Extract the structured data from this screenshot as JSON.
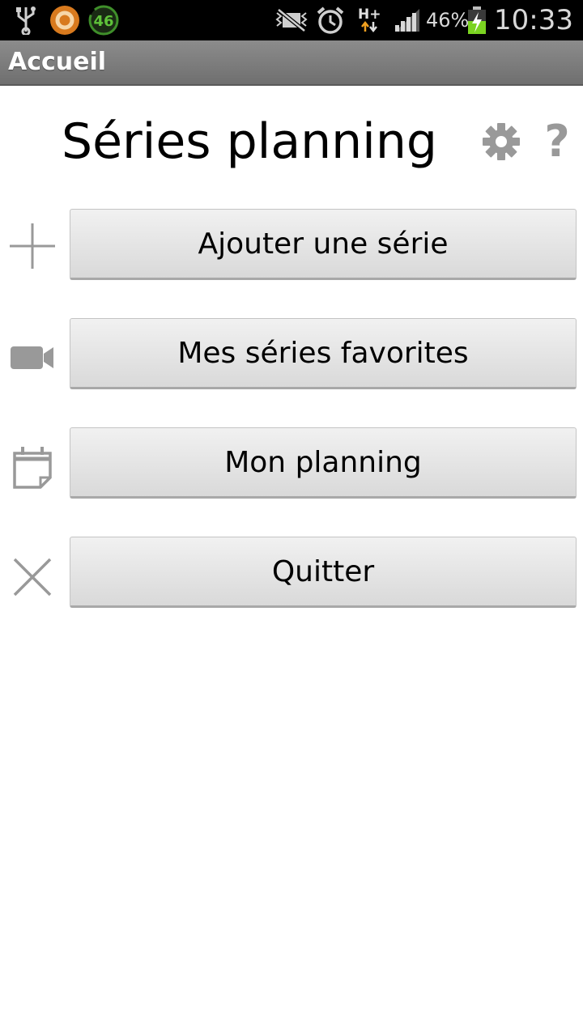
{
  "status_bar": {
    "notification_badge": "46",
    "network_type": "H+",
    "battery_percent": "46%",
    "time": "10:33",
    "icons": [
      "usb-icon",
      "app-orange-icon",
      "app-green-badge-icon",
      "mute-icon",
      "alarm-icon",
      "network-h-plus-icon",
      "signal-icon",
      "battery-charging-icon"
    ]
  },
  "title_bar": {
    "title": "Accueil"
  },
  "main": {
    "app_title": "Séries planning",
    "help_symbol": "?",
    "menu": [
      {
        "label": "Ajouter une série",
        "icon": "plus-icon"
      },
      {
        "label": "Mes séries favorites",
        "icon": "video-camera-icon"
      },
      {
        "label": "Mon planning",
        "icon": "calendar-icon"
      },
      {
        "label": "Quitter",
        "icon": "close-icon"
      }
    ]
  },
  "colors": {
    "status_bar_bg": "#000000",
    "title_bar_bg": "#7d7d7d",
    "icon_gray": "#999999",
    "button_bg": "#e3e3e3"
  }
}
